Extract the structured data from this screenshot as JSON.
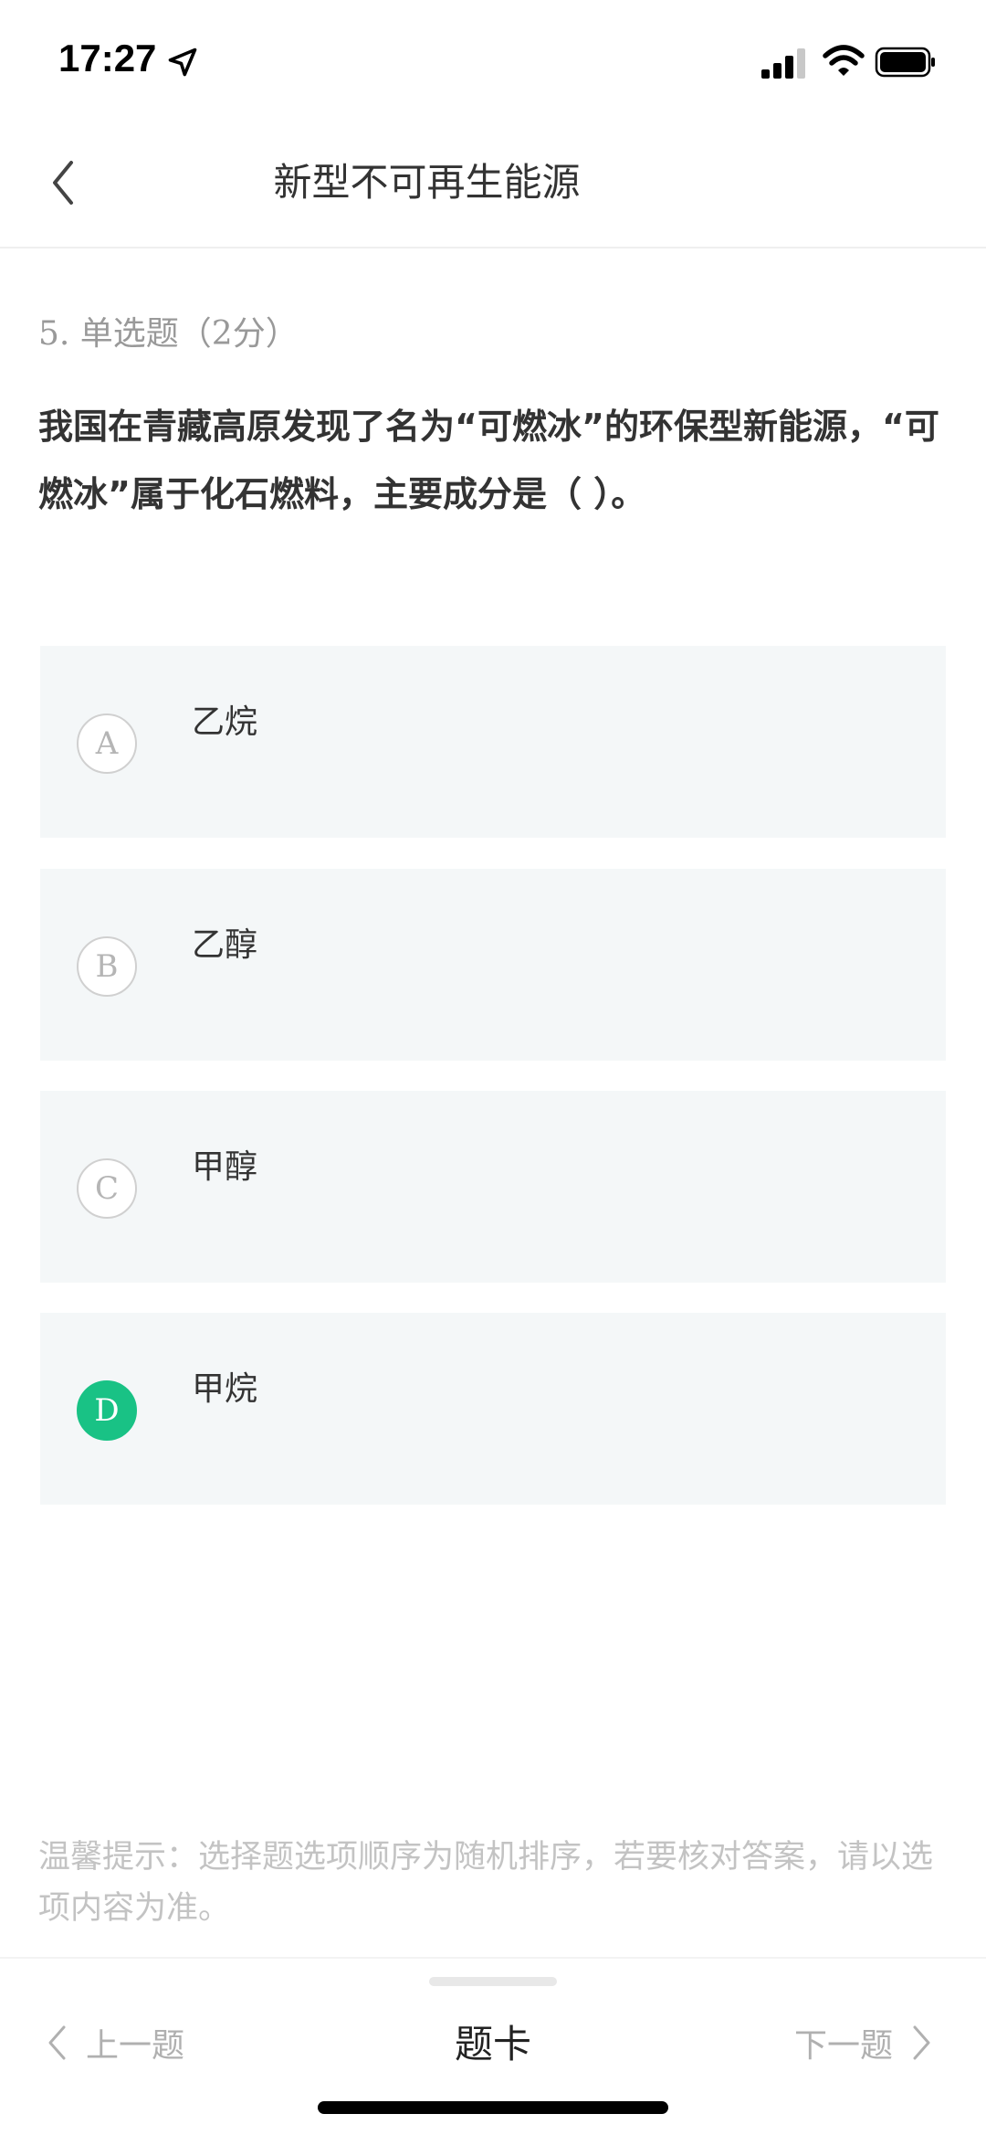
{
  "status_bar": {
    "time": "17:27",
    "icons": [
      "location-arrow-icon",
      "cellular-signal-icon",
      "wifi-icon",
      "battery-icon"
    ]
  },
  "nav": {
    "back_icon": "chevron-left-icon",
    "title": "新型不可再生能源"
  },
  "question": {
    "type_label": "5. 单选题（2分）",
    "text": "我国在青藏高原发现了名为“可燃冰”的环保型新能源，“可燃冰”属于化石燃料，主要成分是（ ）。"
  },
  "options": [
    {
      "letter": "A",
      "text": "乙烷",
      "selected": false
    },
    {
      "letter": "B",
      "text": "乙醇",
      "selected": false
    },
    {
      "letter": "C",
      "text": "甲醇",
      "selected": false
    },
    {
      "letter": "D",
      "text": "甲烷",
      "selected": true
    }
  ],
  "tip": "温馨提示：选择题选项顺序为随机排序，若要核对答案，请以选项内容为准。",
  "bottom_bar": {
    "prev_label": "上一题",
    "card_label": "题卡",
    "next_label": "下一题"
  },
  "colors": {
    "selected_accent": "#19c285",
    "option_bg": "#f4f7f8",
    "muted_text": "#999999"
  }
}
